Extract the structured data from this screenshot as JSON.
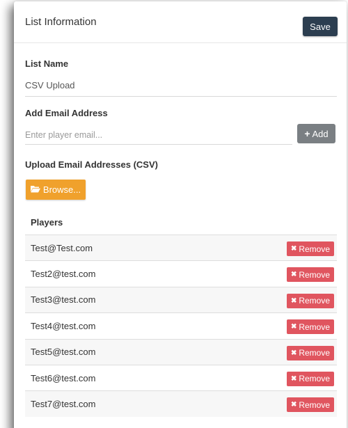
{
  "header": {
    "title": "List Information",
    "save_label": "Save"
  },
  "list_name": {
    "label": "List Name",
    "value": "CSV Upload"
  },
  "add_email": {
    "label": "Add Email Address",
    "placeholder": "Enter player email...",
    "add_label": "Add"
  },
  "upload": {
    "label": "Upload Email Addresses (CSV)",
    "browse_label": "Browse..."
  },
  "players": {
    "label": "Players",
    "remove_label": "Remove",
    "rows": [
      {
        "email": "Test@Test.com"
      },
      {
        "email": "Test2@test.com"
      },
      {
        "email": "Test3@test.com"
      },
      {
        "email": "Test4@test.com"
      },
      {
        "email": "Test5@test.com"
      },
      {
        "email": "Test6@test.com"
      },
      {
        "email": "Test7@test.com"
      }
    ]
  },
  "colors": {
    "save": "#2c3e50",
    "add": "#7a7f83",
    "browse": "#f0a12c",
    "remove": "#e0555f"
  },
  "icons": {
    "add": "plus-icon",
    "browse": "folder-open-icon",
    "remove": "x-icon"
  }
}
